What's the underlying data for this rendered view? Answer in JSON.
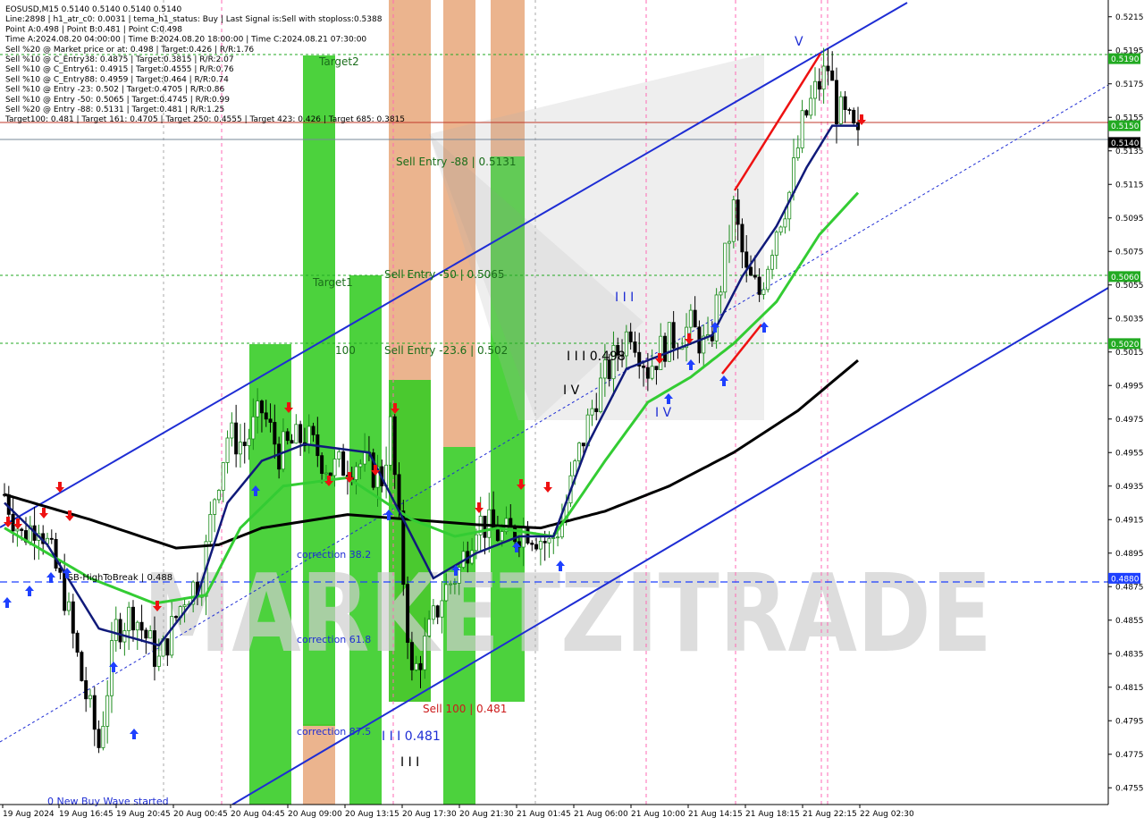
{
  "header": {
    "lines": [
      "EOSUSD,M15  0.5140 0.5140 0.5140 0.5140",
      "Line:2898  |  h1_atr_c0: 0.0031  |  tema_h1_status: Buy  |  Last Signal is:Sell with stoploss:0.5388",
      "Point A:0.498  |  Point B:0.481  |  Point C:0.498",
      "Time A:2024.08.20 04:00:00  |  Time B:2024.08.20 18:00:00  |  Time C:2024.08.21 07:30:00",
      "Sell %20 @ Market price or at: 0.498  |  Target:0.426  |  R/R:1.76",
      "Sell %10 @ C_Entry38: 0.4875  |  Target:0.3815  |  R/R:2.07",
      "Sell %10 @ C_Entry61: 0.4915  |  Target:0.4555  |  R/R:0.76",
      "Sell %10 @ C_Entry88: 0.4959  |  Target:0.464  |  R/R:0.74",
      "Sell %10 @ Entry -23: 0.502  |  Target:0.4705  |  R/R:0.86",
      "Sell %10 @ Entry -50: 0.5065  |  Target:0.4745  |  R/R:0.99",
      "Sell %20 @ Entry -88: 0.5131  |  Target:0.481  |  R/R:1.25",
      "Target100: 0.481  |  Target 161: 0.4705  |  Target 250: 0.4555  |  Target 423: 0.426  |  Target 685: 0.3815"
    ]
  },
  "watermark": "MARKETZITRADE",
  "price_badges": [
    {
      "value": "0.5190",
      "color": "#22aa22"
    },
    {
      "value": "0.5150",
      "color": "#22aa22"
    },
    {
      "value": "0.5140",
      "color": "#000000"
    },
    {
      "value": "0.5060",
      "color": "#22aa22"
    },
    {
      "value": "0.5020",
      "color": "#22aa22"
    },
    {
      "value": "0.4880",
      "color": "#1e40ff"
    }
  ],
  "annotations": {
    "target2": "Target2",
    "target1": "Target1",
    "hundred": "100",
    "sell_entry_88": "Sell Entry -88 | 0.5131",
    "sell_entry_50": "Sell Entry -50 | 0.5065",
    "sell_entry_23": "Sell Entry -23.6 | 0.502",
    "correction_382": "correction 38.2",
    "correction_618": "correction 61.8",
    "correction_875": "correction 87.5",
    "fsb": "FSB-HighToBreak | 0.488",
    "sell_100": "Sell 100 | 0.481",
    "wave_0481": "I I I 0.481",
    "wave_iii_bottom": "I I I",
    "wave_0498": "I I I 0.498",
    "wave_iv_top": "I V",
    "wave_iv_mid": "I V",
    "wave_iii_top": "I I I",
    "wave_v": "V",
    "new_wave": "0 New Buy Wave started",
    "target_overlap": "Target685: 0.3815"
  },
  "chart_data": {
    "type": "candlestick",
    "symbol": "EOSUSD",
    "timeframe": "M15",
    "y_range": [
      0.4745,
      0.5225
    ],
    "y_ticks": [
      "0.5215",
      "0.5195",
      "0.5175",
      "0.5155",
      "0.5135",
      "0.5115",
      "0.5095",
      "0.5075",
      "0.5055",
      "0.5035",
      "0.5015",
      "0.4995",
      "0.4975",
      "0.4955",
      "0.4935",
      "0.4915",
      "0.4895",
      "0.4875",
      "0.4855",
      "0.4835",
      "0.4815",
      "0.4795",
      "0.4775",
      "0.4755"
    ],
    "x_ticks": [
      "19 Aug 2024",
      "19 Aug 16:45",
      "19 Aug 20:45",
      "20 Aug 00:45",
      "20 Aug 04:45",
      "20 Aug 09:00",
      "20 Aug 13:15",
      "20 Aug 17:30",
      "20 Aug 21:30",
      "21 Aug 01:45",
      "21 Aug 06:00",
      "21 Aug 10:00",
      "21 Aug 14:15",
      "21 Aug 18:15",
      "21 Aug 22:15",
      "22 Aug 02:30"
    ],
    "price_key_points": [
      {
        "x": 0,
        "y": 0.493
      },
      {
        "x": 4,
        "y": 0.4905
      },
      {
        "x": 8,
        "y": 0.4915
      },
      {
        "x": 14,
        "y": 0.487
      },
      {
        "x": 18,
        "y": 0.482
      },
      {
        "x": 22,
        "y": 0.478
      },
      {
        "x": 26,
        "y": 0.485
      },
      {
        "x": 30,
        "y": 0.486
      },
      {
        "x": 36,
        "y": 0.483
      },
      {
        "x": 42,
        "y": 0.487
      },
      {
        "x": 46,
        "y": 0.488
      },
      {
        "x": 49,
        "y": 0.493
      },
      {
        "x": 52,
        "y": 0.4965
      },
      {
        "x": 56,
        "y": 0.496
      },
      {
        "x": 60,
        "y": 0.498
      },
      {
        "x": 64,
        "y": 0.4955
      },
      {
        "x": 70,
        "y": 0.4965
      },
      {
        "x": 76,
        "y": 0.4945
      },
      {
        "x": 82,
        "y": 0.495
      },
      {
        "x": 88,
        "y": 0.494
      },
      {
        "x": 90,
        "y": 0.497
      },
      {
        "x": 93,
        "y": 0.488
      },
      {
        "x": 95,
        "y": 0.482
      },
      {
        "x": 98,
        "y": 0.484
      },
      {
        "x": 102,
        "y": 0.487
      },
      {
        "x": 106,
        "y": 0.4885
      },
      {
        "x": 110,
        "y": 0.4915
      },
      {
        "x": 116,
        "y": 0.4905
      },
      {
        "x": 122,
        "y": 0.491
      },
      {
        "x": 127,
        "y": 0.49
      },
      {
        "x": 130,
        "y": 0.4915
      },
      {
        "x": 134,
        "y": 0.4955
      },
      {
        "x": 138,
        "y": 0.499
      },
      {
        "x": 142,
        "y": 0.501
      },
      {
        "x": 146,
        "y": 0.503
      },
      {
        "x": 150,
        "y": 0.5005
      },
      {
        "x": 154,
        "y": 0.502
      },
      {
        "x": 160,
        "y": 0.503
      },
      {
        "x": 164,
        "y": 0.5015
      },
      {
        "x": 168,
        "y": 0.507
      },
      {
        "x": 170,
        "y": 0.51
      },
      {
        "x": 173,
        "y": 0.506
      },
      {
        "x": 176,
        "y": 0.505
      },
      {
        "x": 180,
        "y": 0.509
      },
      {
        "x": 183,
        "y": 0.511
      },
      {
        "x": 186,
        "y": 0.515
      },
      {
        "x": 189,
        "y": 0.517
      },
      {
        "x": 192,
        "y": 0.5185
      },
      {
        "x": 194,
        "y": 0.516
      },
      {
        "x": 197,
        "y": 0.515
      },
      {
        "x": 199,
        "y": 0.514
      }
    ],
    "ma_slow": [
      {
        "x": 0,
        "y": 0.493
      },
      {
        "x": 20,
        "y": 0.4915
      },
      {
        "x": 40,
        "y": 0.4898
      },
      {
        "x": 50,
        "y": 0.49
      },
      {
        "x": 60,
        "y": 0.491
      },
      {
        "x": 80,
        "y": 0.4918
      },
      {
        "x": 95,
        "y": 0.4915
      },
      {
        "x": 110,
        "y": 0.4912
      },
      {
        "x": 125,
        "y": 0.491
      },
      {
        "x": 140,
        "y": 0.492
      },
      {
        "x": 155,
        "y": 0.4935
      },
      {
        "x": 170,
        "y": 0.4955
      },
      {
        "x": 185,
        "y": 0.498
      },
      {
        "x": 199,
        "y": 0.501
      }
    ],
    "ma_mid": [
      {
        "x": 0,
        "y": 0.491
      },
      {
        "x": 20,
        "y": 0.488
      },
      {
        "x": 35,
        "y": 0.4865
      },
      {
        "x": 47,
        "y": 0.487
      },
      {
        "x": 55,
        "y": 0.491
      },
      {
        "x": 65,
        "y": 0.4935
      },
      {
        "x": 80,
        "y": 0.494
      },
      {
        "x": 95,
        "y": 0.4915
      },
      {
        "x": 105,
        "y": 0.4905
      },
      {
        "x": 115,
        "y": 0.491
      },
      {
        "x": 128,
        "y": 0.4905
      },
      {
        "x": 140,
        "y": 0.495
      },
      {
        "x": 150,
        "y": 0.4985
      },
      {
        "x": 160,
        "y": 0.5
      },
      {
        "x": 170,
        "y": 0.502
      },
      {
        "x": 180,
        "y": 0.5045
      },
      {
        "x": 190,
        "y": 0.5085
      },
      {
        "x": 199,
        "y": 0.511
      }
    ],
    "ma_fast": [
      {
        "x": 0,
        "y": 0.4925
      },
      {
        "x": 10,
        "y": 0.49
      },
      {
        "x": 22,
        "y": 0.485
      },
      {
        "x": 36,
        "y": 0.484
      },
      {
        "x": 45,
        "y": 0.487
      },
      {
        "x": 52,
        "y": 0.4925
      },
      {
        "x": 60,
        "y": 0.495
      },
      {
        "x": 70,
        "y": 0.496
      },
      {
        "x": 85,
        "y": 0.4955
      },
      {
        "x": 92,
        "y": 0.492
      },
      {
        "x": 100,
        "y": 0.488
      },
      {
        "x": 110,
        "y": 0.4895
      },
      {
        "x": 120,
        "y": 0.4905
      },
      {
        "x": 128,
        "y": 0.4905
      },
      {
        "x": 136,
        "y": 0.496
      },
      {
        "x": 145,
        "y": 0.5005
      },
      {
        "x": 155,
        "y": 0.5015
      },
      {
        "x": 165,
        "y": 0.5025
      },
      {
        "x": 172,
        "y": 0.506
      },
      {
        "x": 180,
        "y": 0.509
      },
      {
        "x": 187,
        "y": 0.5125
      },
      {
        "x": 193,
        "y": 0.515
      },
      {
        "x": 199,
        "y": 0.515
      }
    ],
    "grid": false
  }
}
